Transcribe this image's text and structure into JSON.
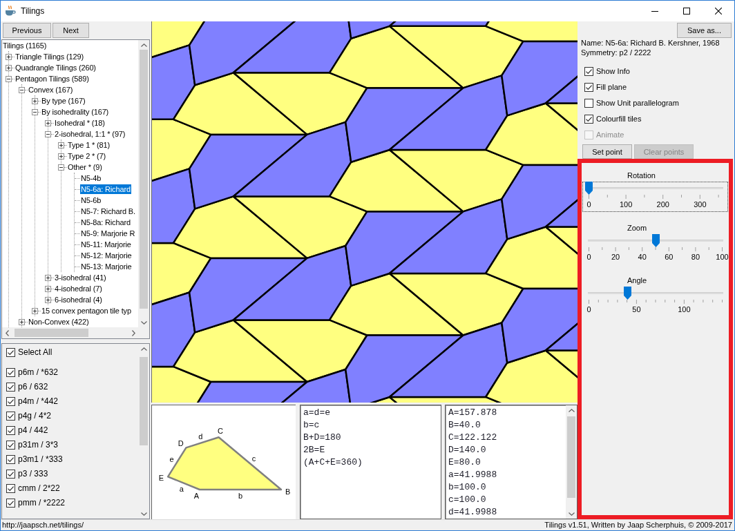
{
  "window": {
    "title": "Tilings"
  },
  "nav_buttons": [
    "Previous",
    "Next"
  ],
  "tree": {
    "label": "Tilings (1165)",
    "selected": false,
    "children": [
      {
        "label": "Triangle Tilings (129)",
        "expanded": false,
        "selected": false
      },
      {
        "label": "Quadrangle Tilings (260)",
        "expanded": false,
        "selected": false
      },
      {
        "label": "Pentagon Tilings (589)",
        "expanded": true,
        "selected": false,
        "children": [
          {
            "label": "Convex (167)",
            "expanded": true,
            "selected": false,
            "children": [
              {
                "label": "By type (167)",
                "expanded": false,
                "selected": false
              },
              {
                "label": "By isohedrality (167)",
                "expanded": true,
                "selected": false,
                "children": [
                  {
                    "label": "Isohedral * (18)",
                    "expanded": false,
                    "selected": false
                  },
                  {
                    "label": "2-isohedral, 1:1 * (97)",
                    "expanded": true,
                    "selected": false,
                    "children": [
                      {
                        "label": "Type 1 * (81)",
                        "expanded": false,
                        "selected": false
                      },
                      {
                        "label": "Type 2 * (7)",
                        "expanded": false,
                        "selected": false
                      },
                      {
                        "label": "Other * (9)",
                        "expanded": true,
                        "selected": false,
                        "children": [
                          {
                            "label": "N5-4b",
                            "selected": false
                          },
                          {
                            "label": "N5-6a: Richard",
                            "selected": true
                          },
                          {
                            "label": "N5-6b",
                            "selected": false
                          },
                          {
                            "label": "N5-7: Richard B.",
                            "selected": false
                          },
                          {
                            "label": "N5-8a: Richard",
                            "selected": false
                          },
                          {
                            "label": "N5-9: Marjorie R",
                            "selected": false
                          },
                          {
                            "label": "N5-11: Marjorie",
                            "selected": false
                          },
                          {
                            "label": "N5-12: Marjorie",
                            "selected": false
                          },
                          {
                            "label": "N5-13: Marjorie",
                            "selected": false
                          }
                        ]
                      }
                    ]
                  },
                  {
                    "label": "3-isohedral (41)",
                    "expanded": false,
                    "selected": false
                  },
                  {
                    "label": "4-isohedral (7)",
                    "expanded": false,
                    "selected": false
                  },
                  {
                    "label": "6-isohedral (4)",
                    "expanded": false,
                    "selected": false
                  }
                ]
              },
              {
                "label": "15 convex pentagon tile typ",
                "expanded": false,
                "selected": false
              }
            ]
          },
          {
            "label": "Non-Convex (422)",
            "expanded": false,
            "selected": false
          }
        ]
      }
    ]
  },
  "symmetry_filter": {
    "select_all": {
      "label": "Select All",
      "checked": true
    },
    "groups": [
      {
        "label": "p6m / *632",
        "checked": true
      },
      {
        "label": "p6 / 632",
        "checked": true
      },
      {
        "label": "p4m / *442",
        "checked": true
      },
      {
        "label": "p4g / 4*2",
        "checked": true
      },
      {
        "label": "p4 / 442",
        "checked": true
      },
      {
        "label": "p31m / 3*3",
        "checked": true
      },
      {
        "label": "p3m1 / *333",
        "checked": true
      },
      {
        "label": "p3 / 333",
        "checked": true
      },
      {
        "label": "cmm / 2*22",
        "checked": true
      },
      {
        "label": "pmm / *2222",
        "checked": true
      }
    ]
  },
  "diagram": {
    "vertex_labels": [
      "A",
      "B",
      "C",
      "D",
      "E"
    ],
    "edge_labels": [
      "a",
      "b",
      "c",
      "d",
      "e"
    ]
  },
  "relations": [
    "a=d=e",
    "b=c",
    "B+D=180",
    "2B=E",
    "(A+C+E=360)"
  ],
  "measurements": [
    "A=157.878",
    "B=40.0",
    "C=122.122",
    "D=140.0",
    "E=80.0",
    "a=41.9988",
    "b=100.0",
    "c=100.0",
    "d=41.9988"
  ],
  "save_button": "Save as...",
  "info": [
    "Name: N5-6a: Richard B. Kershner, 1968",
    "Symmetry: p2 / 2222"
  ],
  "options": [
    {
      "label": "Show Info",
      "checked": true,
      "disabled": false
    },
    {
      "label": "Fill plane",
      "checked": true,
      "disabled": false
    },
    {
      "label": "Show Unit parallelogram",
      "checked": false,
      "disabled": false
    },
    {
      "label": "Colourfill tiles",
      "checked": true,
      "disabled": false
    },
    {
      "label": "Animate",
      "checked": false,
      "disabled": true
    }
  ],
  "point_buttons": [
    {
      "label": "Set point",
      "disabled": false
    },
    {
      "label": "Clear points",
      "disabled": true
    }
  ],
  "sliders": [
    {
      "label": "Rotation",
      "level": 0,
      "focused": true,
      "tick_labels": [
        "0",
        "100",
        "200",
        "300"
      ]
    },
    {
      "label": "Zoom",
      "level": 0.5,
      "focused": false,
      "tick_labels": [
        "0",
        "20",
        "40",
        "60",
        "80",
        "100"
      ]
    },
    {
      "label": "Angle",
      "level": 0.29,
      "focused": false,
      "tick_labels": [
        "0",
        "50",
        "100"
      ]
    }
  ],
  "status_bar": {
    "url": "http://jaapsch.net/tilings/",
    "credits": "Tilings v1.51, Written by Jaap Scherphuis, © 2009-2017"
  }
}
